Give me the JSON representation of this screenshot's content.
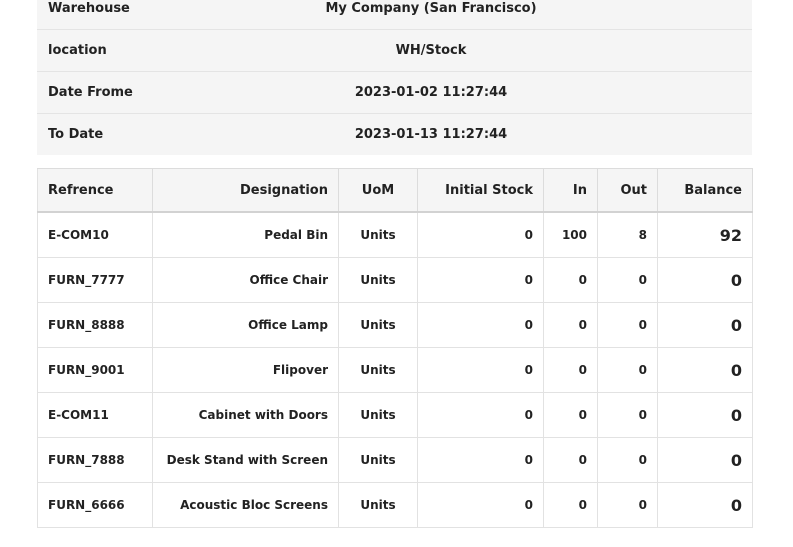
{
  "info": [
    {
      "label": "Warehouse",
      "value": "My Company (San Francisco)"
    },
    {
      "label": "location",
      "value": "WH/Stock"
    },
    {
      "label": "Date Frome",
      "value": "2023-01-02 11:27:44"
    },
    {
      "label": "To Date",
      "value": "2023-01-13 11:27:44"
    }
  ],
  "table": {
    "headers": [
      "Refrence",
      "Designation",
      "UoM",
      "Initial Stock",
      "In",
      "Out",
      "Balance"
    ],
    "rows": [
      [
        "E-COM10",
        "Pedal Bin",
        "Units",
        "0",
        "100",
        "8",
        "92"
      ],
      [
        "FURN_7777",
        "Office Chair",
        "Units",
        "0",
        "0",
        "0",
        "0"
      ],
      [
        "FURN_8888",
        "Office Lamp",
        "Units",
        "0",
        "0",
        "0",
        "0"
      ],
      [
        "FURN_9001",
        "Flipover",
        "Units",
        "0",
        "0",
        "0",
        "0"
      ],
      [
        "E-COM11",
        "Cabinet with Doors",
        "Units",
        "0",
        "0",
        "0",
        "0"
      ],
      [
        "FURN_7888",
        "Desk Stand with Screen",
        "Units",
        "0",
        "0",
        "0",
        "0"
      ],
      [
        "FURN_6666",
        "Acoustic Bloc Screens",
        "Units",
        "0",
        "0",
        "0",
        "0"
      ]
    ]
  }
}
